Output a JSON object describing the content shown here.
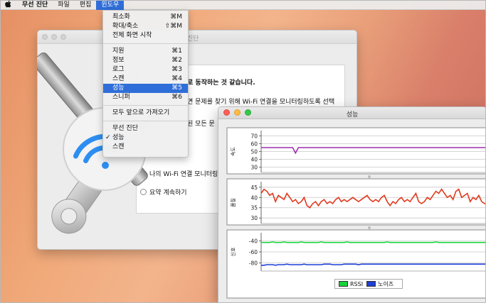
{
  "menubar": {
    "app_name": "무선 진단",
    "items": [
      "파일",
      "편집",
      "윈도우"
    ]
  },
  "window_menu": {
    "items": [
      {
        "label": "최소화",
        "shortcut": "⌘M"
      },
      {
        "label": "확대/축소",
        "shortcut": "⇧⌘M"
      },
      {
        "label": "전체 화면 시작",
        "shortcut": ""
      },
      {
        "label": "지원",
        "shortcut": "⌘1"
      },
      {
        "label": "정보",
        "shortcut": "⌘2"
      },
      {
        "label": "로그",
        "shortcut": "⌘3"
      },
      {
        "label": "스캔",
        "shortcut": "⌘4"
      },
      {
        "label": "성능",
        "shortcut": "⌘5"
      },
      {
        "label": "스니퍼",
        "shortcut": "⌘6"
      },
      {
        "label": "모두 앞으로 가져오기",
        "shortcut": ""
      },
      {
        "label": "무선 진단",
        "shortcut": ""
      },
      {
        "label": "성능",
        "shortcut": "",
        "checked": "✓"
      },
      {
        "label": "스캔",
        "shortcut": ""
      }
    ]
  },
  "back_window": {
    "title": "진단",
    "line1": "로 동작하는 것 같습니다.",
    "line2": "면 문제를 찾기 위해 Wi-Fi 연결을 모니터링하도록 선택",
    "line3": "된 모든 문",
    "option_monitor": "나의 Wi-Fi 연결 모니터링",
    "option_summary": "요약 계속하기"
  },
  "perf_window": {
    "title": "성능",
    "legend_rssi": "RSSI",
    "legend_noise": "노이즈"
  },
  "colors": {
    "rate": "#9b2fb0",
    "quality": "#e03a1e",
    "rssi": "#16d43a",
    "noise": "#1f3fd6",
    "menu_highlight": "#2f6ed8"
  },
  "chart_data": [
    {
      "type": "line",
      "ylabel": "속도",
      "yticks": [
        70,
        60,
        50,
        40,
        30
      ],
      "ylim": [
        25,
        75
      ],
      "series": [
        {
          "values": [
            55,
            55,
            55,
            55,
            55,
            55,
            55,
            55,
            55,
            55,
            55,
            55,
            48,
            55,
            55,
            55,
            55,
            55,
            55,
            55,
            55,
            55,
            55,
            55,
            55,
            55,
            55,
            55,
            55,
            55,
            55,
            55,
            55,
            55,
            55,
            55,
            55,
            55,
            55,
            55,
            55,
            55,
            55,
            55,
            55,
            55,
            55,
            55,
            55,
            55,
            55,
            55,
            55,
            55,
            55,
            55,
            55,
            55,
            55,
            55,
            55,
            55,
            55,
            55,
            55,
            55,
            55,
            55,
            55,
            55,
            55,
            55,
            55,
            55,
            55,
            55,
            55,
            55,
            55,
            55
          ]
        }
      ]
    },
    {
      "type": "line",
      "ylabel": "품질",
      "yticks": [
        45,
        40,
        35,
        30
      ],
      "ylim": [
        28,
        47
      ],
      "series": [
        {
          "values": [
            42,
            44,
            43,
            41,
            42,
            38,
            41,
            40,
            39,
            42,
            40,
            38,
            39,
            37,
            38,
            40,
            36,
            35,
            37,
            38,
            36,
            38,
            39,
            37,
            38,
            37,
            39,
            40,
            38,
            39,
            38,
            39,
            40,
            39,
            38,
            39,
            40,
            41,
            39,
            38,
            39,
            38,
            40,
            41,
            38,
            36,
            38,
            37,
            39,
            40,
            38,
            39,
            38,
            40,
            42,
            38,
            37,
            38,
            40,
            39,
            41,
            43,
            42,
            44,
            42,
            40,
            41,
            39,
            43,
            44,
            40,
            41,
            42,
            38,
            40,
            39,
            41,
            38,
            37,
            37
          ]
        }
      ]
    },
    {
      "type": "line",
      "ylabel": "신호",
      "yticks": [
        -40,
        -60,
        -80
      ],
      "ylim": [
        -92,
        -28
      ],
      "series": [
        {
          "name": "RSSI",
          "values": [
            -43,
            -43,
            -43,
            -43,
            -42,
            -43,
            -43,
            -43,
            -42,
            -43,
            -43,
            -43,
            -43,
            -43,
            -42,
            -43,
            -43,
            -43,
            -43,
            -43,
            -43,
            -42,
            -43,
            -43,
            -43,
            -43,
            -43,
            -43,
            -43,
            -43,
            -42,
            -43,
            -43,
            -43,
            -43,
            -43,
            -43,
            -43,
            -43,
            -43,
            -43,
            -43,
            -43,
            -43,
            -42,
            -43,
            -43,
            -43,
            -43,
            -43,
            -43,
            -43,
            -43,
            -43,
            -43,
            -43,
            -43,
            -43,
            -43,
            -43,
            -43,
            -42,
            -43,
            -43,
            -43,
            -43,
            -43,
            -43,
            -43,
            -43,
            -43,
            -43,
            -43,
            -43,
            -43,
            -43,
            -43,
            -43,
            -43,
            -43
          ]
        },
        {
          "name": "노이즈",
          "values": [
            -84,
            -84,
            -83,
            -83,
            -83,
            -84,
            -83,
            -83,
            -83,
            -82,
            -83,
            -83,
            -83,
            -83,
            -83,
            -82,
            -83,
            -83,
            -83,
            -83,
            -83,
            -83,
            -82,
            -82,
            -82,
            -83,
            -83,
            -83,
            -83,
            -82,
            -82,
            -82,
            -82,
            -82,
            -83,
            -82,
            -82,
            -82,
            -82,
            -82,
            -82,
            -82,
            -82,
            -82,
            -82,
            -82,
            -82,
            -82,
            -82,
            -82,
            -82,
            -82,
            -82,
            -82,
            -82,
            -82,
            -82,
            -82,
            -82,
            -82,
            -82,
            -82,
            -82,
            -82,
            -82,
            -82,
            -82,
            -82,
            -82,
            -82,
            -82,
            -82,
            -82,
            -82,
            -82,
            -82,
            -82,
            -82,
            -82,
            -82
          ]
        }
      ]
    }
  ]
}
